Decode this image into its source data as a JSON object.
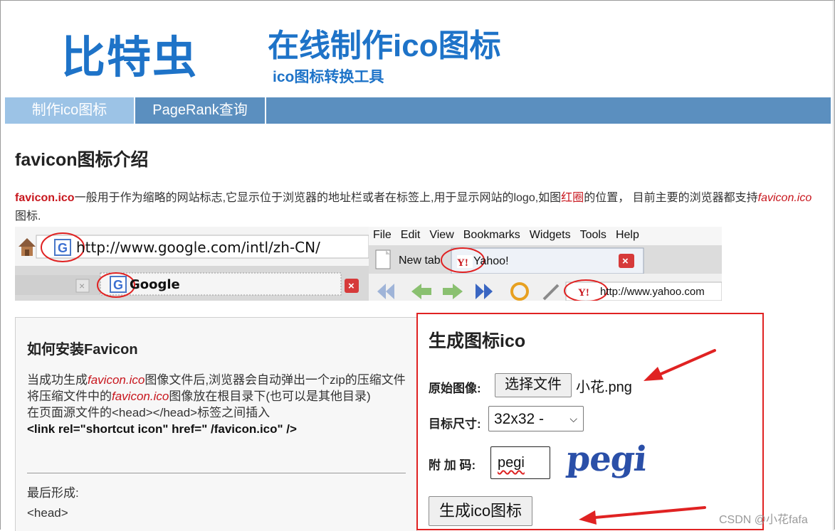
{
  "header": {
    "logo": "比特虫",
    "title": "在线制作ico图标",
    "subtitle": "ico图标转换工具"
  },
  "nav": {
    "items": [
      {
        "label": "制作ico图标",
        "active": true
      },
      {
        "label": "PageRank查询",
        "active": false
      }
    ]
  },
  "intro": {
    "heading": "favicon图标介绍",
    "term": "favicon.ico",
    "p1": "一般用于作为缩略的网站标志,它显示位于浏览器的地址栏或者在标签上,用于显示网站的logo,如图",
    "red_circle": "红圈",
    "p2": "的位置， 目前主要的浏览器都支持",
    "term_italic": "favicon.ico",
    "p3": "图标."
  },
  "screenshot_left": {
    "address": "http://www.google.com/intl/zh-CN/",
    "tab_label": "Google"
  },
  "screenshot_right": {
    "menu": [
      "File",
      "Edit",
      "View",
      "Bookmarks",
      "Widgets",
      "Tools",
      "Help"
    ],
    "tab_new": "New tab",
    "tab_active": "Yahoo!",
    "address": "http://www.yahoo.com",
    "favicon_text": "Y!"
  },
  "install": {
    "title": "如何安装Favicon",
    "line1_pre": "当成功生成",
    "line1_term": "favicon.ico",
    "line1_post": "图像文件后,浏览器会自动弹出一个zip的压缩文件",
    "line2_pre": "将压缩文件中的",
    "line2_term": "favicon.ico",
    "line2_post": "图像放在根目录下(也可以是其他目录)",
    "line3": "在页面源文件的<head></head>标签之间插入",
    "code": "<link rel=\"shortcut icon\" href=\" /favicon.ico\" />",
    "after1": "最后形成:",
    "after2": "<head>"
  },
  "generator": {
    "title": "生成图标ico",
    "source_label": "原始图像:",
    "file_button": "选择文件",
    "file_name": "小花.png",
    "size_label": "目标尺寸:",
    "size_value": "32x32 -",
    "code_label": "附 加 码:",
    "code_value": "pegi",
    "captcha_text": "pegi",
    "submit": "生成ico图标"
  },
  "watermark": "CSDN @小花fafa",
  "colors": {
    "brand_blue": "#1e73c8",
    "nav_bg": "#5b8fbf",
    "nav_active": "#9cc3e6",
    "highlight_red": "#e02222"
  }
}
